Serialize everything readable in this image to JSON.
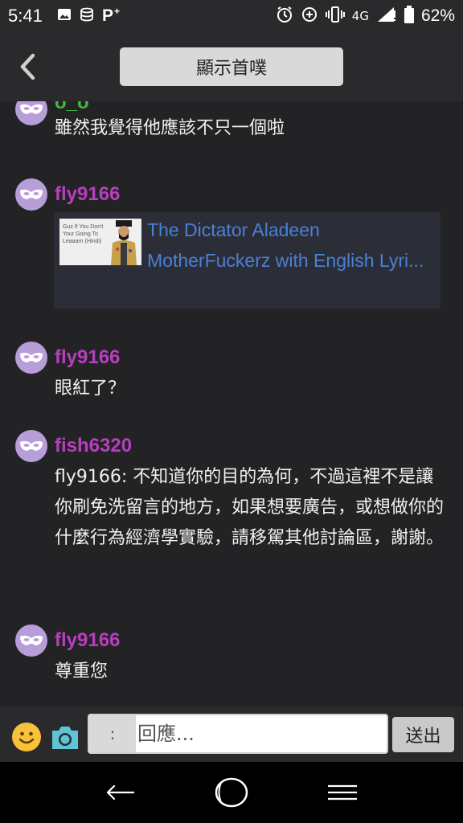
{
  "status_bar": {
    "time": "5:41",
    "network": "4G",
    "battery": "62%"
  },
  "header": {
    "home_button_label": "顯示首噗"
  },
  "feed": {
    "posts": [
      {
        "username": "ö_ö",
        "message": "雖然我覺得他應該不只一個啦"
      },
      {
        "username": "fly9166",
        "link": {
          "title": "The Dictator Aladeen MotherFuckerz with English Lyri...",
          "thumb_text": "Guz If You Don't Your Going To Leaaarn (Hindi)"
        }
      },
      {
        "username": "fly9166",
        "message": "眼紅了？"
      },
      {
        "username": "fish6320",
        "message": "fly9166: 不知道你的目的為何，不過這裡不是讓你刷免洗留言的地方，如果想要廣告，或想做你的什麼行為經濟學實驗，請移駕其他討論區，謝謝。"
      },
      {
        "username": "fly9166",
        "message": "尊重您"
      }
    ]
  },
  "reply_bar": {
    "prefix": ":",
    "placeholder": "回應...",
    "send_label": "送出"
  },
  "icons": {
    "status_left": [
      "image-icon",
      "database-icon",
      "parking-icon"
    ],
    "status_right": [
      "alarm-icon",
      "data-saver-icon",
      "vibrate-icon",
      "signal-icon",
      "battery-icon"
    ],
    "avatar": "mask-icon",
    "reply": [
      "smile-icon",
      "camera-icon"
    ],
    "nav": [
      "back-arrow-icon",
      "home-circle-icon",
      "menu-icon"
    ]
  },
  "colors": {
    "background": "#232325",
    "username": "#b63fbd",
    "link": "#4a80d8",
    "avatar": "#b89ed8"
  }
}
